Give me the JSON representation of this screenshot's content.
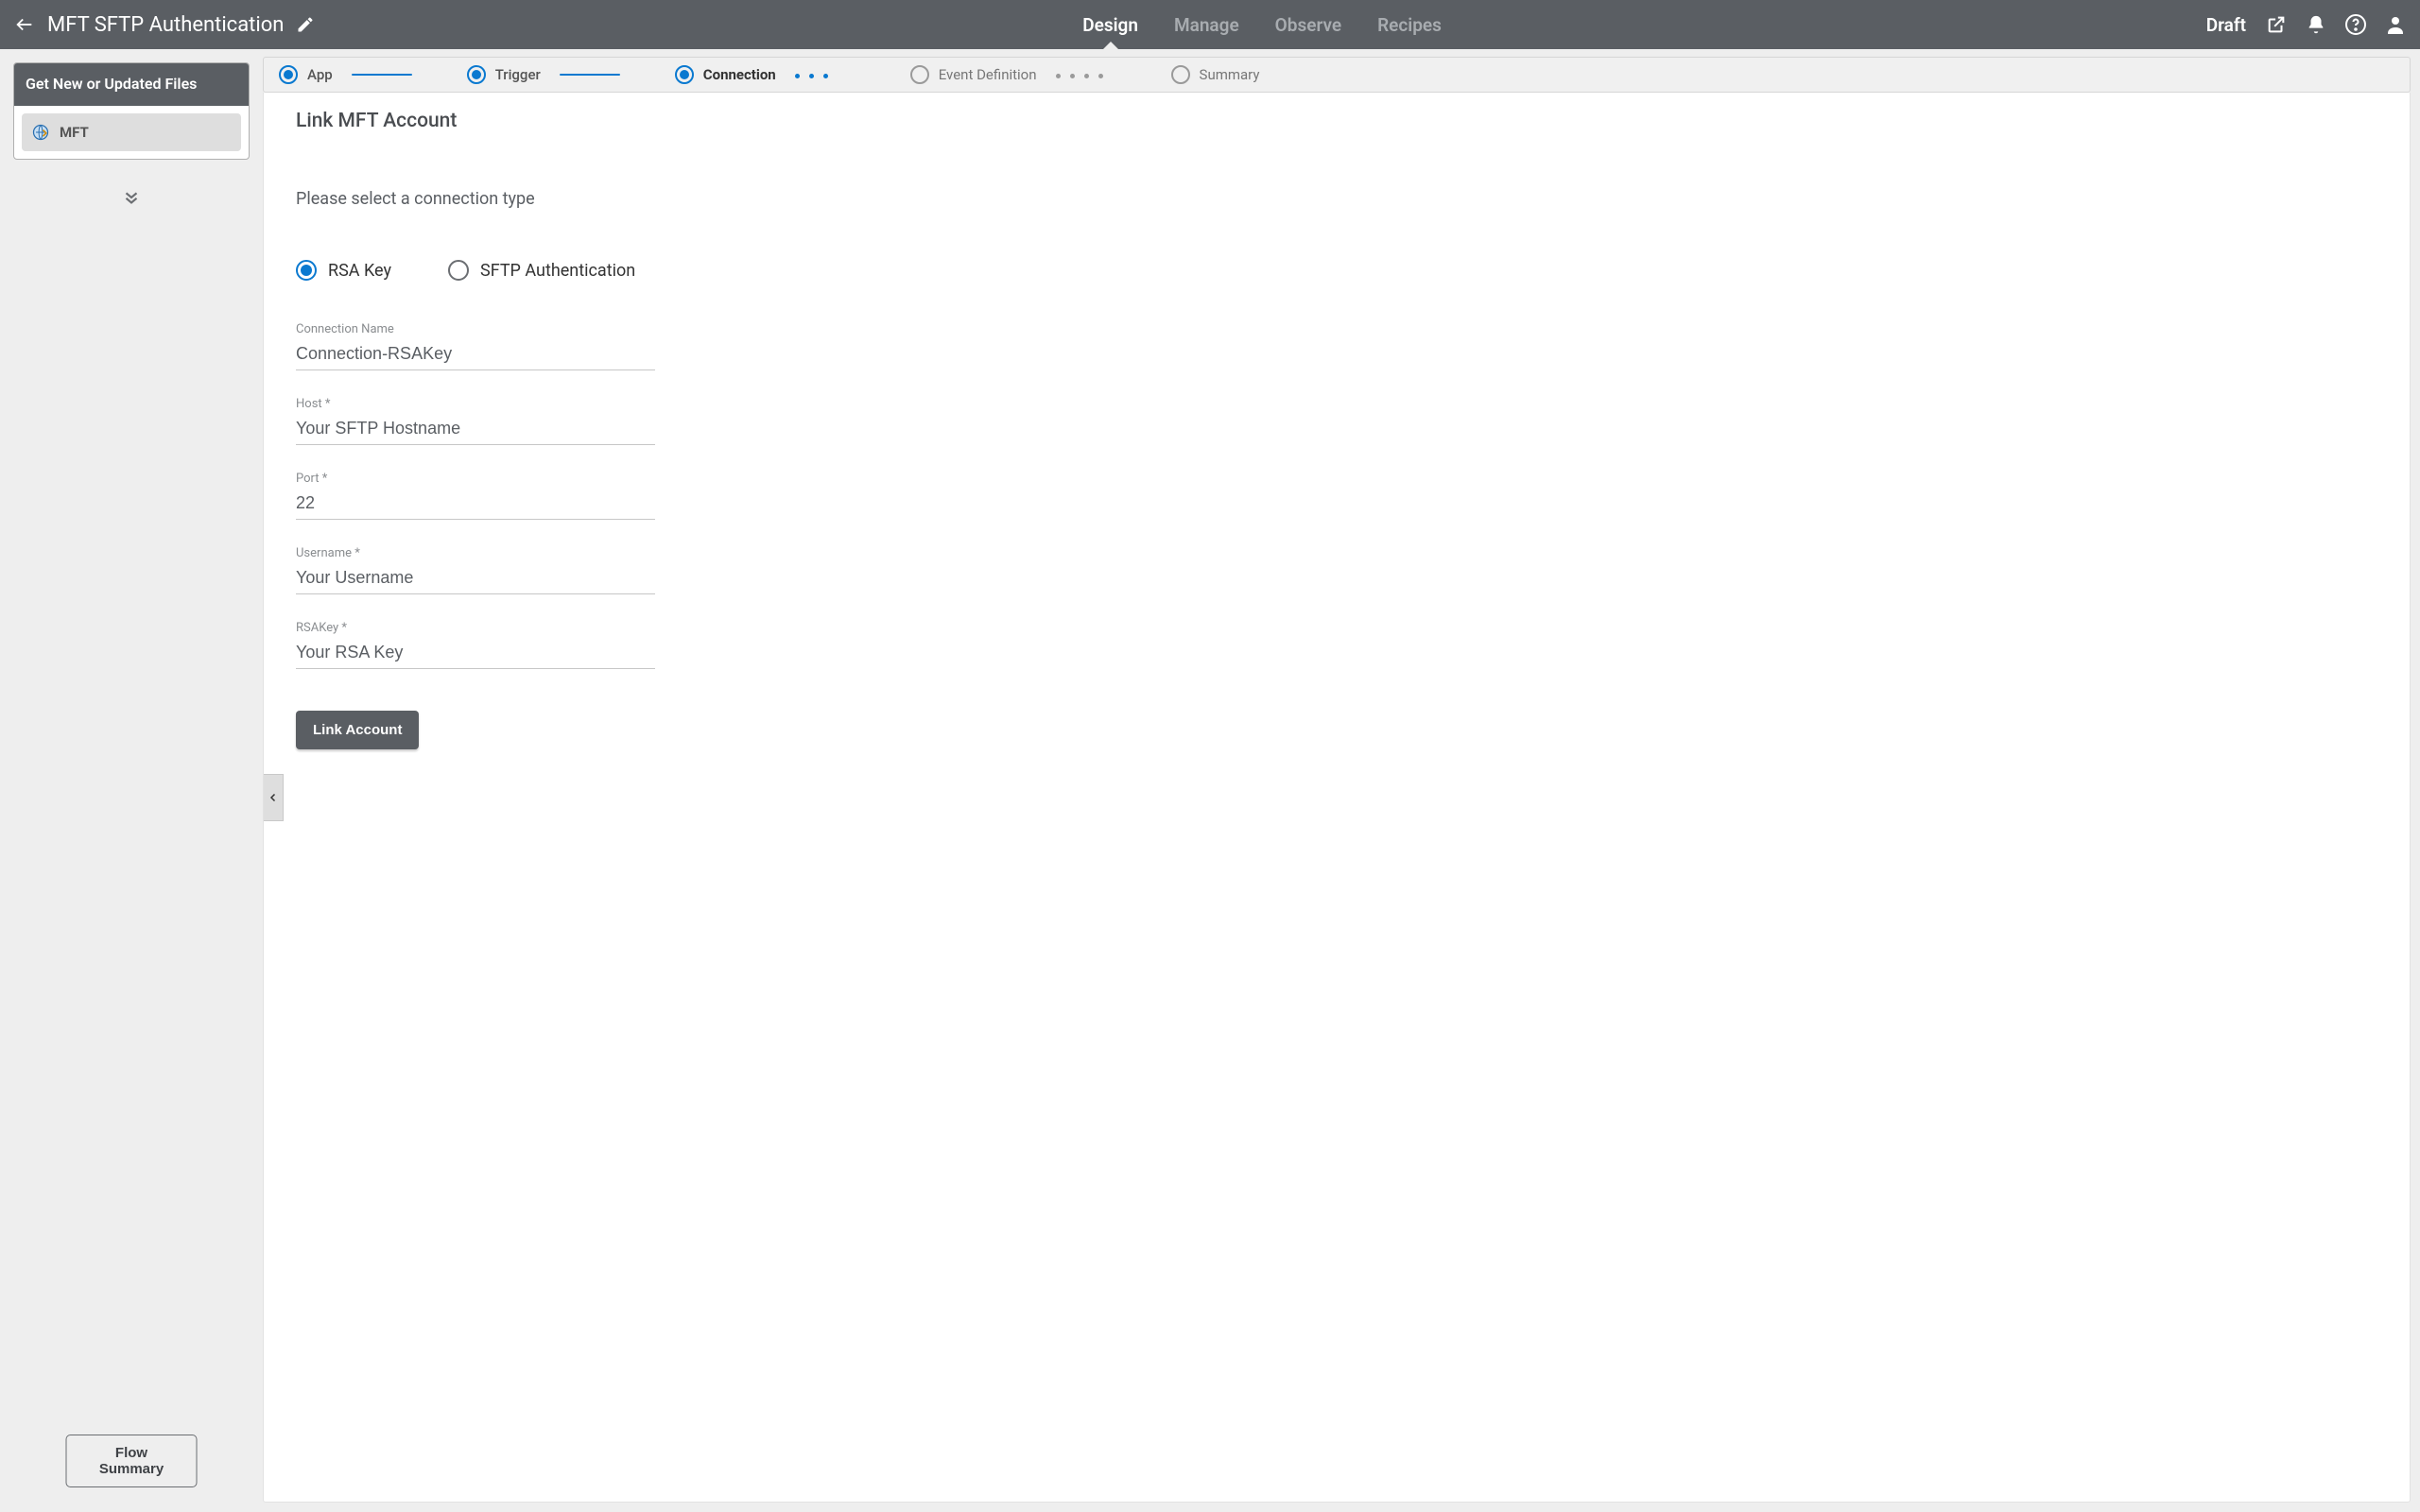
{
  "header": {
    "title": "MFT SFTP Authentication",
    "nav": [
      "Design",
      "Manage",
      "Observe",
      "Recipes"
    ],
    "nav_active": 0,
    "status": "Draft"
  },
  "sidebar": {
    "card_title": "Get New or Updated Files",
    "app_name": "MFT",
    "flow_summary_btn": "Flow Summary"
  },
  "stepper": {
    "steps": [
      {
        "label": "App",
        "state": "done"
      },
      {
        "label": "Trigger",
        "state": "done"
      },
      {
        "label": "Connection",
        "state": "current"
      },
      {
        "label": "Event Definition",
        "state": "todo"
      },
      {
        "label": "Summary",
        "state": "todo"
      }
    ]
  },
  "content": {
    "title": "Link MFT Account",
    "lead": "Please select a connection type",
    "radio_rsa": "RSA Key",
    "radio_sftp": "SFTP Authentication",
    "fields": {
      "connection_name": {
        "label": "Connection Name",
        "value": "Connection-RSAKey"
      },
      "host": {
        "label": "Host *",
        "placeholder": "Your SFTP Hostname"
      },
      "port": {
        "label": "Port *",
        "value": "22"
      },
      "username": {
        "label": "Username *",
        "placeholder": "Your Username"
      },
      "rsakey": {
        "label": "RSAKey *",
        "placeholder": "Your RSA Key"
      }
    },
    "link_btn": "Link Account"
  }
}
